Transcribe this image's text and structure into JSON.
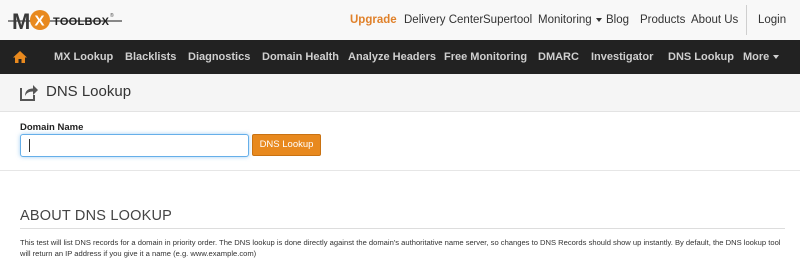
{
  "app": {
    "logo_text": "MXTOOLBOX"
  },
  "topnav": {
    "upgrade": "Upgrade",
    "delivery_center": "Delivery Center",
    "supertool": "Supertool",
    "monitoring": "Monitoring",
    "blog": "Blog",
    "products": "Products",
    "about_us": "About Us",
    "login": "Login"
  },
  "navbar": {
    "items": [
      "MX Lookup",
      "Blacklists",
      "Diagnostics",
      "Domain Health",
      "Analyze Headers",
      "Free Monitoring",
      "DMARC",
      "Investigator",
      "DNS Lookup",
      "More"
    ]
  },
  "page": {
    "title": "DNS Lookup"
  },
  "form": {
    "label": "Domain Name",
    "value": "",
    "placeholder": "",
    "button": "DNS Lookup"
  },
  "about": {
    "heading": "ABOUT DNS LOOKUP",
    "body": "This test will list DNS records for a domain in priority order. The DNS lookup is done directly against the domain's authoritative name server, so changes to DNS Records should show up instantly. By default, the DNS lookup tool will return an IP address if you give it a name (e.g. www.example.com)"
  },
  "colors": {
    "accent": "#e8891e",
    "navbar_bg": "#222222",
    "link_upgrade": "#e0812a"
  },
  "icons": [
    "home-icon",
    "share-arrow-icon",
    "chevron-down-icon"
  ]
}
